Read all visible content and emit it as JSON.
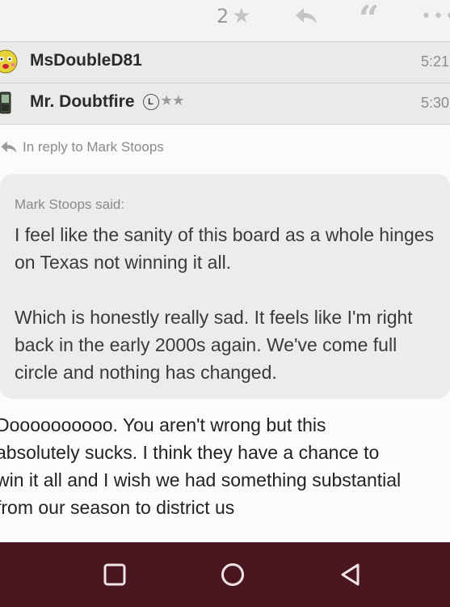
{
  "post_actions": {
    "like_count": "2",
    "like_icon": "star-icon",
    "reply_icon": "reply-arrow-icon",
    "quote_icon": "quote-icon",
    "more_icon": "more-dots-icon"
  },
  "likers": [
    {
      "name": "MsDoubleD81",
      "time": "5:21",
      "avatar_icon": "smiley-avatar"
    },
    {
      "name": "Mr. Doubtfire",
      "time": "5:30",
      "avatar_icon": "phone-avatar",
      "badge": "L",
      "stars": "★★"
    }
  ],
  "post": {
    "in_reply_to": "In reply to Mark Stoops",
    "quote": {
      "author": "Mark Stoops said:",
      "paragraphs": [
        "I feel like the sanity of this board as a whole hinges on Texas not winning it all.",
        "Which is honestly really sad. It feels like I'm right back in the early 2000s again. We've come full circle and nothing has changed."
      ]
    },
    "body_lines": [
      "Doooooooooo. You aren't wrong but this",
      "absolutely sucks. I think they have a chance to",
      "win it all and I wish we had something substantial",
      "from our season to district us"
    ]
  },
  "navbar": {
    "color": "#4a1620",
    "buttons": [
      "recent-apps-button",
      "home-button",
      "back-button"
    ]
  }
}
